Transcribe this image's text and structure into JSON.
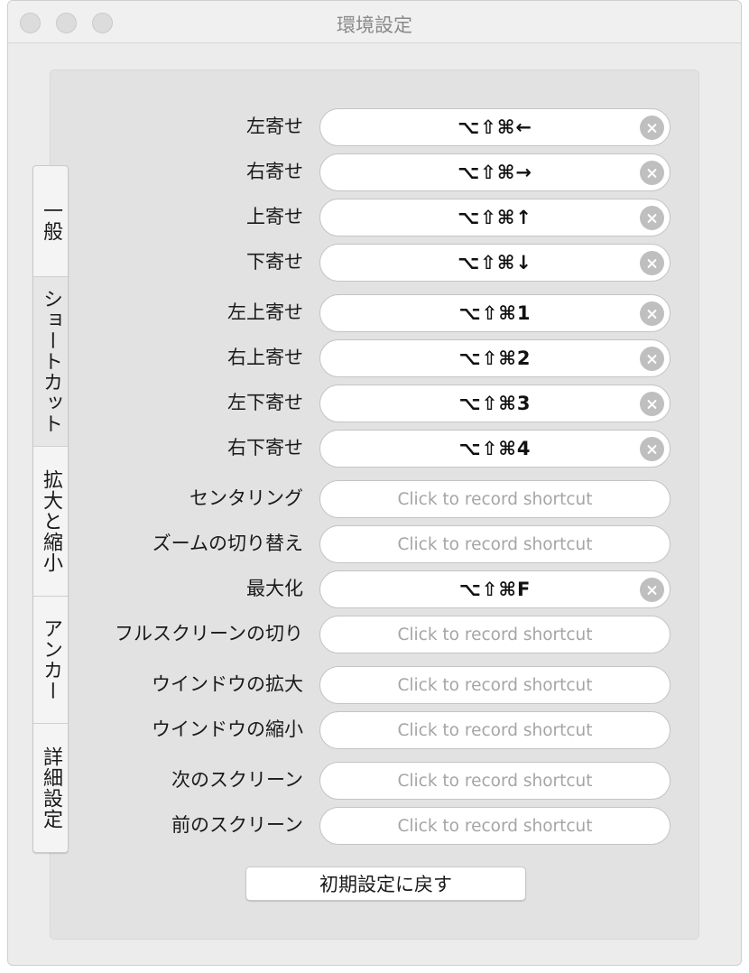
{
  "window": {
    "title": "環境設定"
  },
  "tabs": [
    {
      "label": "一般",
      "selected": false
    },
    {
      "label": "ショートカット",
      "selected": true
    },
    {
      "label": "拡大と縮小",
      "selected": false
    },
    {
      "label": "アンカー",
      "selected": false
    },
    {
      "label": "詳細設定",
      "selected": false
    }
  ],
  "placeholder": "Click to record shortcut",
  "shortcuts": [
    {
      "label": "左寄せ",
      "value": "⌥⇧⌘←"
    },
    {
      "label": "右寄せ",
      "value": "⌥⇧⌘→"
    },
    {
      "label": "上寄せ",
      "value": "⌥⇧⌘↑"
    },
    {
      "label": "下寄せ",
      "value": "⌥⇧⌘↓"
    },
    {
      "label": "左上寄せ",
      "value": "⌥⇧⌘1"
    },
    {
      "label": "右上寄せ",
      "value": "⌥⇧⌘2"
    },
    {
      "label": "左下寄せ",
      "value": "⌥⇧⌘3"
    },
    {
      "label": "右下寄せ",
      "value": "⌥⇧⌘4"
    },
    {
      "label": "センタリング",
      "value": ""
    },
    {
      "label": "ズームの切り替え",
      "value": ""
    },
    {
      "label": "最大化",
      "value": "⌥⇧⌘F"
    },
    {
      "label": "フルスクリーンの切り",
      "value": ""
    },
    {
      "label": "ウインドウの拡大",
      "value": ""
    },
    {
      "label": "ウインドウの縮小",
      "value": ""
    },
    {
      "label": "次のスクリーン",
      "value": ""
    },
    {
      "label": "前のスクリーン",
      "value": ""
    }
  ],
  "reset_button": {
    "label": "初期設定に戻す"
  }
}
